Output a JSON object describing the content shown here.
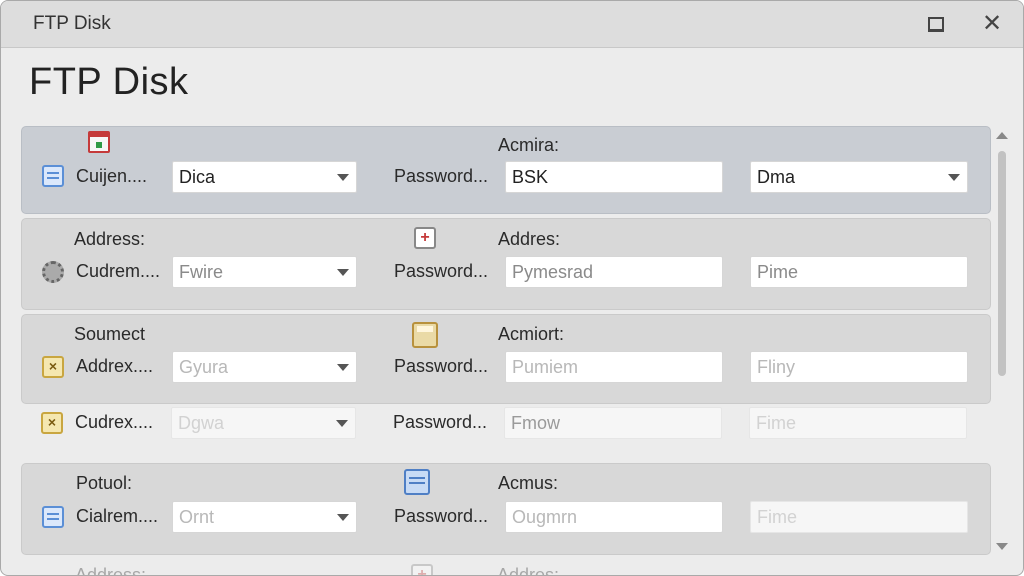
{
  "window": {
    "title": "FTP Disk",
    "heading": "FTP Disk"
  },
  "titlebar": {
    "maximize_icon": "maximize-icon",
    "close_icon": "close-icon",
    "close_glyph": "✕"
  },
  "rows": [
    {
      "top_left": "",
      "top_mid": "Acmira:",
      "label1": "Cuijen....",
      "combo1": "Dica",
      "label2": "Password...",
      "field2": "BSK",
      "field3": "Dma",
      "field3_dropdown": true,
      "left_icon": "calendar-icon",
      "mid_icon": "pin-icon"
    },
    {
      "top_left": "Address:",
      "top_mid": "Addres:",
      "label1": "Cudrem....",
      "combo1": "Fwire",
      "label2": "Password...",
      "field2": "Pymesrad",
      "field3": "Pime",
      "left_icon": "gear-icon",
      "mid_icon": "add-icon"
    },
    {
      "top_left": "Soumect",
      "top_mid": "Acmiort:",
      "label1": "Addrex....",
      "combo1": "Gyura",
      "label2": "Password...",
      "field2": "Pumiem",
      "field3": "Fliny",
      "left_icon": "x-box-icon",
      "mid_icon": "disk-icon"
    },
    {
      "top_left": "",
      "top_mid": "",
      "label1": "Cudrex....",
      "combo1": "Dgwa",
      "label2": "Password...",
      "field2": "Fmow",
      "field3": "Fime",
      "left_icon": "x-box-icon"
    },
    {
      "top_left": "Potuol:",
      "top_mid": "Acmus:",
      "label1": "Cialrem....",
      "combo1": "Ornt",
      "label2": "Password...",
      "field2": "Ougmrn",
      "field3": "Fime",
      "left_icon": "calendar-icon",
      "mid_icon": "document-icon"
    },
    {
      "top_left": "Address:",
      "top_mid": "Addres:",
      "mid_icon": "add-icon"
    }
  ]
}
